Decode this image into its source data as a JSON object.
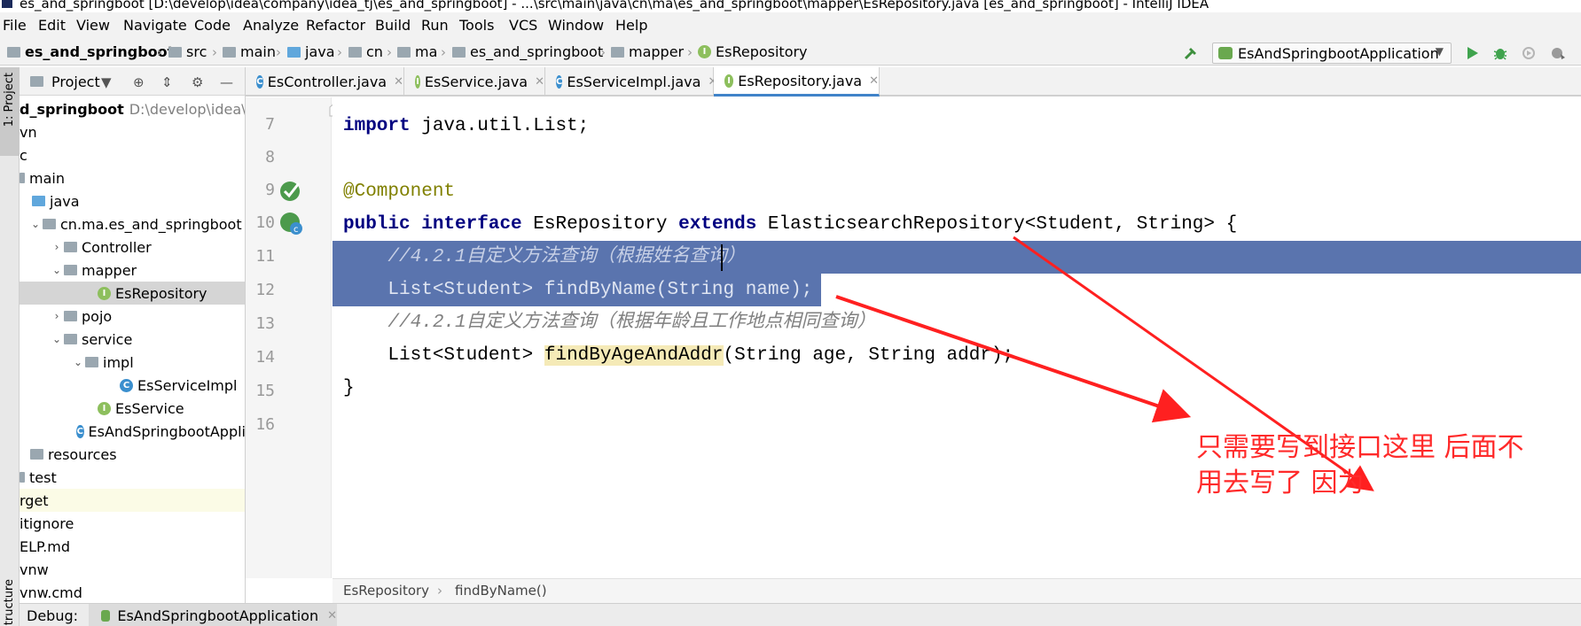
{
  "window": {
    "title": "es_and_springboot [D:\\develop\\idea\\company\\idea_tj\\es_and_springboot] - ...\\src\\main\\java\\cn\\ma\\es_and_springboot\\mapper\\EsRepository.java [es_and_springboot] - IntelliJ IDEA"
  },
  "menu": {
    "items": [
      "File",
      "Edit",
      "View",
      "Navigate",
      "Code",
      "Analyze",
      "Refactor",
      "Build",
      "Run",
      "Tools",
      "VCS",
      "Window",
      "Help"
    ]
  },
  "breadcrumbs": [
    "es_and_springboot",
    "src",
    "main",
    "java",
    "cn",
    "ma",
    "es_and_springboot",
    "mapper",
    "EsRepository"
  ],
  "run_config": {
    "label": "EsAndSpringbootApplication"
  },
  "left_stripe": {
    "project_label": "1: Project",
    "structure_label": "Structure"
  },
  "project_panel": {
    "title": "Project",
    "tree": [
      {
        "label": "d_springboot",
        "path": "D:\\develop\\idea\\co"
      },
      {
        "label": "vn"
      },
      {
        "label": "c"
      },
      {
        "label": "main"
      },
      {
        "label": "java"
      },
      {
        "label": "cn.ma.es_and_springboot"
      },
      {
        "label": "Controller"
      },
      {
        "label": "mapper"
      },
      {
        "label": "EsRepository"
      },
      {
        "label": "pojo"
      },
      {
        "label": "service"
      },
      {
        "label": "impl"
      },
      {
        "label": "EsServiceImpl"
      },
      {
        "label": "EsService"
      },
      {
        "label": "EsAndSpringbootAppli"
      },
      {
        "label": "resources"
      },
      {
        "label": "test"
      },
      {
        "label": "rget"
      },
      {
        "label": "itignore"
      },
      {
        "label": "ELP.md"
      },
      {
        "label": "vnw"
      },
      {
        "label": "vnw.cmd"
      }
    ]
  },
  "editor_tabs": [
    {
      "label": "EsController.java",
      "icon": "class-icon"
    },
    {
      "label": "EsService.java",
      "icon": "interface-icon"
    },
    {
      "label": "EsServiceImpl.java",
      "icon": "class-icon"
    },
    {
      "label": "EsRepository.java",
      "icon": "interface-icon",
      "active": true
    }
  ],
  "code": {
    "line_numbers": [
      "7",
      "8",
      "9",
      "10",
      "11",
      "12",
      "13",
      "14",
      "15",
      "16"
    ],
    "l7_kw": "import",
    "l7_rest": " java.util.List;",
    "l9_ann": "@Component",
    "l10_kw1": "public",
    "l10_kw2": "interface",
    "l10_name": " EsRepository ",
    "l10_kw3": "extends",
    "l10_rest": " ElasticsearchRepository<Student, String> {",
    "l11_comment": "//4.2.1自定义方法查询（根据姓名查询）",
    "l12_code": "List<Student> findByName(String name);",
    "l13_comment": "//4.2.1自定义方法查询（根据年龄且工作地点相同查询）",
    "l14_pre": "List<Student> ",
    "l14_method": "findByAgeAndAddr",
    "l14_post": "(String age, String addr);",
    "l15": "}"
  },
  "annotation": {
    "text_line1": "只需要写到接口这里 后面不",
    "text_line2": "用去写了 因为",
    "color": "#ff2a2a"
  },
  "editor_breadcrumb": [
    "EsRepository",
    "findByName()"
  ],
  "debug_bar": {
    "label": "Debug:",
    "tab": "EsAndSpringbootApplication"
  },
  "colors": {
    "selection": "#5a74ae",
    "keyword": "#000080",
    "annotation_code": "#808000",
    "comment": "#808080",
    "accent": "#4083c9"
  }
}
